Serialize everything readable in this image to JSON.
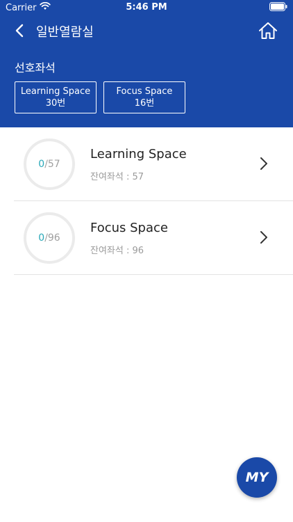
{
  "status_bar": {
    "carrier": "Carrier",
    "time": "5:46 PM"
  },
  "nav": {
    "title": "일반열람실",
    "back_icon": "chevron-left-icon",
    "home_icon": "home-icon"
  },
  "favorites": {
    "label": "선호좌석",
    "items": [
      {
        "room": "Learning Space",
        "seat": "30번"
      },
      {
        "room": "Focus Space",
        "seat": "16번"
      }
    ]
  },
  "rooms": [
    {
      "name": "Learning Space",
      "used": "0",
      "total": "/57",
      "remaining_label": "잔여좌석 : 57"
    },
    {
      "name": "Focus Space",
      "used": "0",
      "total": "/96",
      "remaining_label": "잔여좌석 : 96"
    }
  ],
  "my_button": {
    "label": "MY"
  },
  "colors": {
    "primary": "#1a49a8",
    "accent": "#29a8b8",
    "muted": "#9a9a9a"
  }
}
